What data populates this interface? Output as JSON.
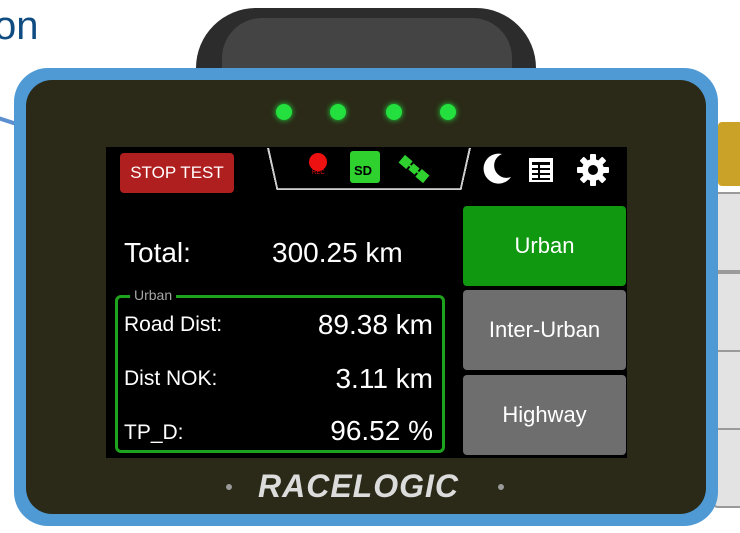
{
  "caption": {
    "partial_text": "on"
  },
  "device": {
    "brand": "RACELOGIC",
    "led_color": "#23e03e",
    "shell_color": "#4f9ad4"
  },
  "toolbar": {
    "stop_label": "STOP TEST",
    "rec_badge": "REC",
    "sd_label": "SD",
    "icons": [
      "rec-icon",
      "sd-card-icon",
      "gps-satellite-icon",
      "moon-icon",
      "table-icon",
      "gear-icon"
    ]
  },
  "summary": {
    "total_label": "Total:",
    "total_value": "300.25 km"
  },
  "urban_panel": {
    "legend": "Urban",
    "rows": [
      {
        "label": "Road Dist:",
        "value": "89.38 km"
      },
      {
        "label": "Dist NOK:",
        "value": "3.11 km"
      },
      {
        "label": "TP_D:",
        "value": "96.52 %"
      }
    ]
  },
  "modes": [
    {
      "label": "Urban",
      "active": true,
      "color": "#109910"
    },
    {
      "label": "Inter-Urban",
      "active": false,
      "color": "#6e6e6e"
    },
    {
      "label": "Highway",
      "active": false,
      "color": "#6e6e6e"
    }
  ]
}
